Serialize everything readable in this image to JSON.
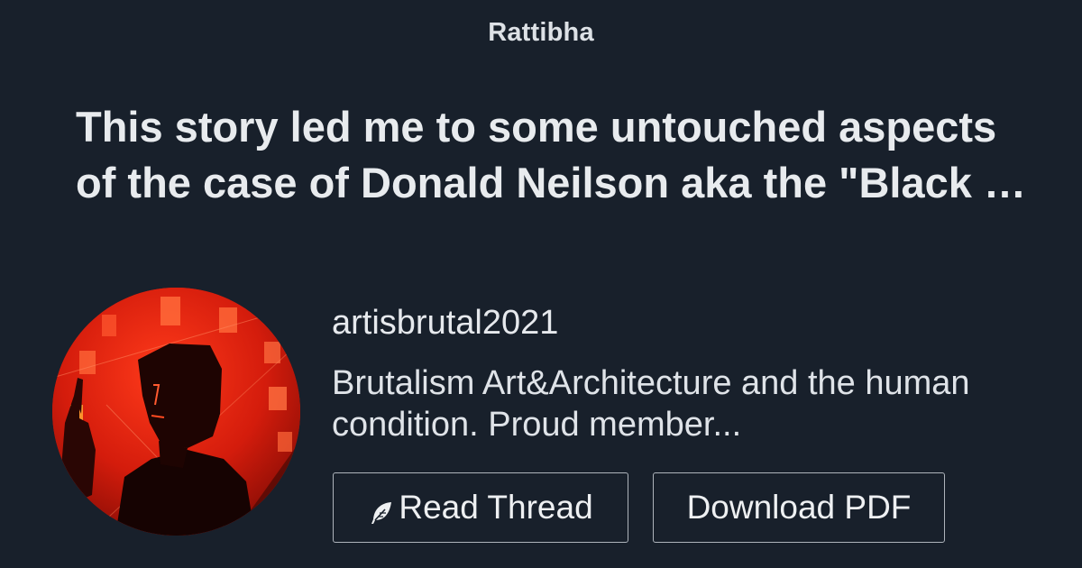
{
  "brand": "Rattibha",
  "headline": {
    "line1": "This story led me to some untouched aspects",
    "line2": "of the case of Donald Neilson aka the \"Black Panther\""
  },
  "profile": {
    "username": "artisbrutal2021",
    "bio_line1": "Brutalism Art&Architecture and the human",
    "bio_line2": "condition. Proud member..."
  },
  "buttons": {
    "read_thread": "Read Thread",
    "download_pdf": "Download PDF"
  },
  "icons": {
    "read_thread_icon": "feather-icon"
  },
  "colors": {
    "background": "#18202b",
    "text": "#e6e9ed",
    "avatar_red": "#c81a0a"
  }
}
